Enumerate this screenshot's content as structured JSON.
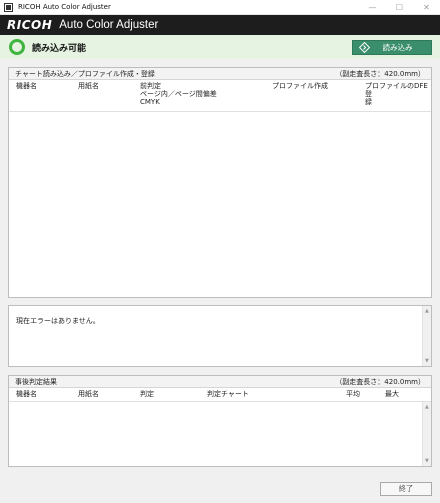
{
  "window": {
    "title": "RICOH Auto Color Adjuster",
    "minimize": "—",
    "maximize": "☐",
    "close": "✕"
  },
  "header": {
    "brand": "RICOH",
    "app_name": "Auto Color Adjuster"
  },
  "status": {
    "text": "読み込み可能",
    "read_button": "読み込み"
  },
  "chart_panel": {
    "title": "チャート読み込み／プロファイル作成・登録",
    "length_note": "（副走査長さ：420.0mm）",
    "columns": {
      "device": "機器名",
      "paper": "用紙名",
      "prejudge": "前判定",
      "prejudge_sub": "ページ内／ページ間偏差",
      "prejudge_sub2": "CMYK",
      "profile": "プロファイル作成",
      "dfe_1": "プロファイルのDFE登",
      "dfe_2": "録"
    }
  },
  "error_panel": {
    "message": "現在エラーはありません。"
  },
  "result_panel": {
    "title": "事後判定結果",
    "length_note": "（副走査長さ：420.0mm）",
    "columns": {
      "device": "機器名",
      "paper": "用紙名",
      "judge": "判定",
      "judge_chart": "判定チャート",
      "average": "平均",
      "max": "最大"
    }
  },
  "footer": {
    "exit_button": "終了"
  },
  "colors": {
    "header_bg": "#1d1d1d",
    "status_bg": "#e6f3e2",
    "status_ring": "#3fb43f",
    "read_button_bg": "#3a8e6b"
  }
}
